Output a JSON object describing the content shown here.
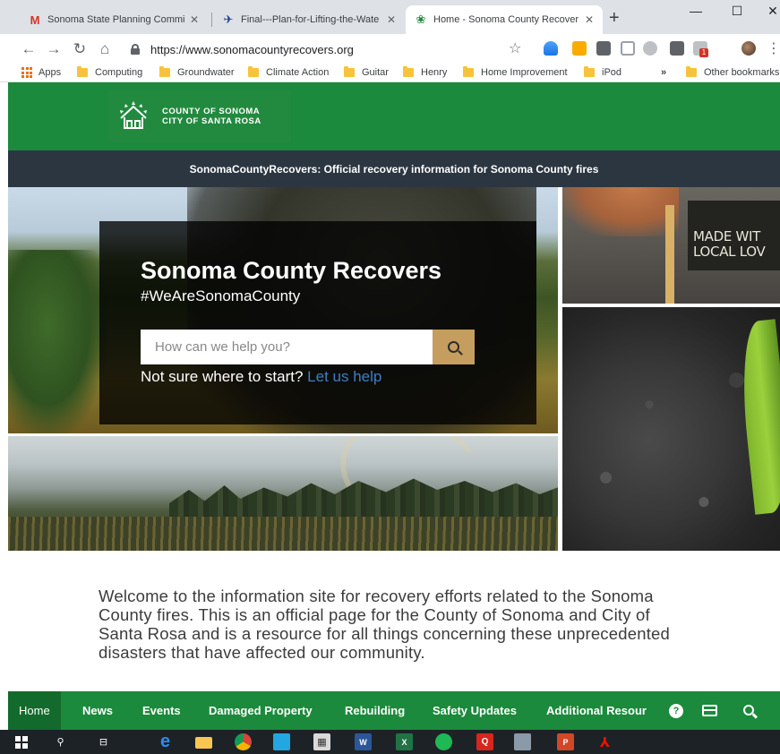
{
  "browser": {
    "tabs": [
      {
        "title": "Sonoma State Planning Commiss",
        "icon": "gmail-icon",
        "active": false
      },
      {
        "title": "Final---Plan-for-Lifting-the-Wate",
        "icon": "document-icon",
        "active": false
      },
      {
        "title": "Home - Sonoma County Recover",
        "icon": "site-icon",
        "active": true
      }
    ],
    "new_tab": "+",
    "url": "https://www.sonomacountyrecovers.org",
    "bookmarks": [
      "Apps",
      "Computing",
      "Groundwater",
      "Climate Action",
      "Guitar",
      "Henry",
      "Home Improvement",
      "iPod"
    ],
    "overflow": "»",
    "other_bookmarks": "Other bookmarks",
    "extension_badge": "1"
  },
  "site": {
    "logo_line1": "COUNTY OF SONOMA",
    "logo_line2": "CITY OF SANTA ROSA",
    "banner": "SonomaCountyRecovers: Official recovery information for Sonoma County fires",
    "hero": {
      "title": "Sonoma County Recovers",
      "hashtag": "#WeAreSonomaCounty",
      "search_placeholder": "How can we help you?",
      "help_prefix": "Not sure where to start?",
      "help_link": "Let us help"
    },
    "sign_text_1": "MADE WIT",
    "sign_text_2": "LOCAL LOV",
    "welcome": "Welcome to the information site for recovery efforts related to the Sonoma County fires. This is an official page for the County of Sonoma and City of Santa Rosa and is a resource for all things concerning these unprecedented disasters that have affected our community.",
    "nav": [
      "Home",
      "News",
      "Events",
      "Damaged Property",
      "Rebuilding",
      "Safety Updates",
      "Additional Resour"
    ],
    "nav_help_icon": "?"
  },
  "colors": {
    "brand_green": "#1b8a3c",
    "nav_active": "#126b2c",
    "banner_dark": "#2b3641",
    "search_button": "#c59d5f",
    "link_blue": "#3f7fc1"
  }
}
